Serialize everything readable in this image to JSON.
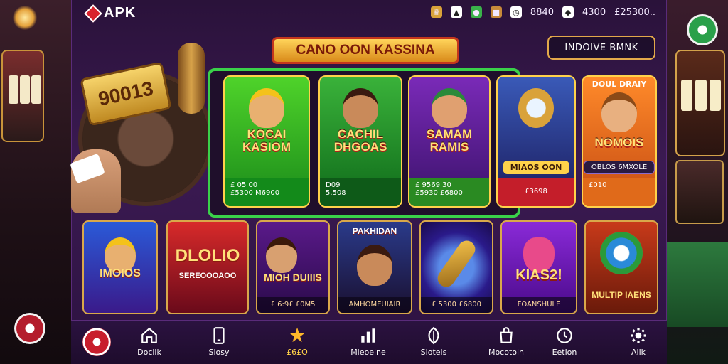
{
  "app": {
    "brand": "APK",
    "title": "CANO OON KASSINA",
    "nav_button": "INDOIVE BMNK"
  },
  "status": {
    "coins": "8840",
    "gems": "4300",
    "balance": "£25300.."
  },
  "jackpot": {
    "value": "90013"
  },
  "featured": [
    {
      "title": "KOCAI KASIOM",
      "line1": "£ 05 00",
      "line2": "£5300 M6900",
      "theme": "green"
    },
    {
      "title": "CACHIL DHGOAS",
      "line1": "D09",
      "line2": "5.508",
      "theme": "green"
    },
    {
      "title": "SAMAM RAMIS",
      "line1": "£ 9569 30",
      "line2": "£5930 £6800",
      "theme": "purple"
    },
    {
      "title": "",
      "pill": "MIAOS OON",
      "footer": "£3698",
      "theme": "red"
    },
    {
      "title": "NOMOIS",
      "header": "DOUL DRAIY",
      "pill": "OBLOS 6MXOLE",
      "footer": "£010",
      "theme": "orange"
    }
  ],
  "tiles": [
    {
      "title": "IMOIOS",
      "footer": ""
    },
    {
      "title": "DLOLIO",
      "subtitle": "SEREOOOAOO",
      "footer": ""
    },
    {
      "title": "MIOH DUIIIS",
      "footer": "£ 6:9£ £0M5"
    },
    {
      "title": "",
      "header": "PAKHIDAN",
      "footer": "AMHOMEUIAIR"
    },
    {
      "title": "",
      "footer": "£ 5300 £6800"
    },
    {
      "title": "KIAS2!",
      "footer": "FOANSHULE"
    },
    {
      "title": "MULTIP IAENS",
      "footer": ""
    }
  ],
  "bottom_nav": [
    {
      "label": "",
      "icon": "chip-icon"
    },
    {
      "label": "Docilk",
      "icon": "home-icon"
    },
    {
      "label": "Slosy",
      "icon": "phone-icon"
    },
    {
      "label": "£6£O",
      "icon": "star-icon"
    },
    {
      "label": "Mleoeine",
      "icon": "bar-chart-icon"
    },
    {
      "label": "Slotels",
      "icon": "leaf-icon"
    },
    {
      "label": "Mocotoin",
      "icon": "bag-icon"
    },
    {
      "label": "Eetion",
      "icon": "clock-icon"
    },
    {
      "label": "Ailk",
      "icon": "gear-icon"
    }
  ]
}
